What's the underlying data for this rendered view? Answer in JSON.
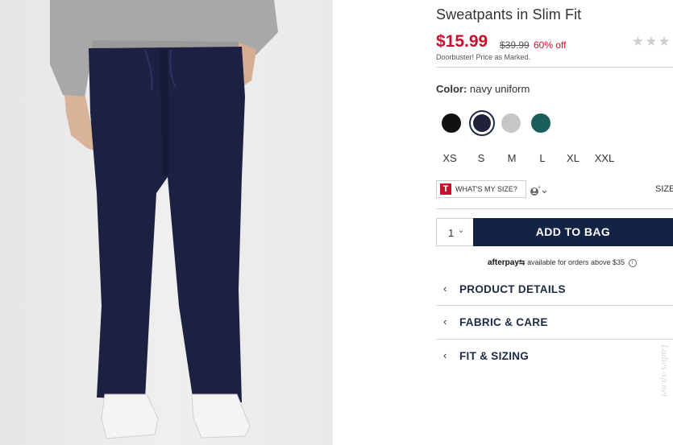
{
  "product": {
    "title": "Sweatpants in Slim Fit",
    "price": "$15.99",
    "original_price": "$39.99",
    "discount": "60% off",
    "promo": "Doorbuster! Price as Marked.",
    "rating_stars": "★★★"
  },
  "color": {
    "label": "Color:",
    "value": "navy uniform",
    "swatches": [
      {
        "name": "black",
        "hex": "#111111"
      },
      {
        "name": "navy uniform",
        "hex": "#1f2238",
        "selected": true
      },
      {
        "name": "light heather grey",
        "hex": "#c6c6c6"
      },
      {
        "name": "teal",
        "hex": "#1a5f5c"
      }
    ]
  },
  "sizes": [
    "XS",
    "S",
    "M",
    "L",
    "XL",
    "XXL"
  ],
  "fit": {
    "logo_letter": "T",
    "whats_my_size": "WHAT'S MY SIZE?",
    "profile_icon": "user-profile-icon",
    "size_link": "SIZE"
  },
  "purchase": {
    "quantity": "1",
    "add_to_bag": "ADD TO BAG"
  },
  "afterpay": {
    "brand": "afterpay",
    "text": "available for orders above $35",
    "info": "i"
  },
  "accordion": [
    {
      "label": "PRODUCT DETAILS"
    },
    {
      "label": "FABRIC & CARE"
    },
    {
      "label": "FIT & SIZING"
    }
  ],
  "watermark": "Ladies-xp.net",
  "colors": {
    "sale_red": "#c8102e",
    "navy_button": "#122344",
    "pant_navy": "#1c2142"
  }
}
